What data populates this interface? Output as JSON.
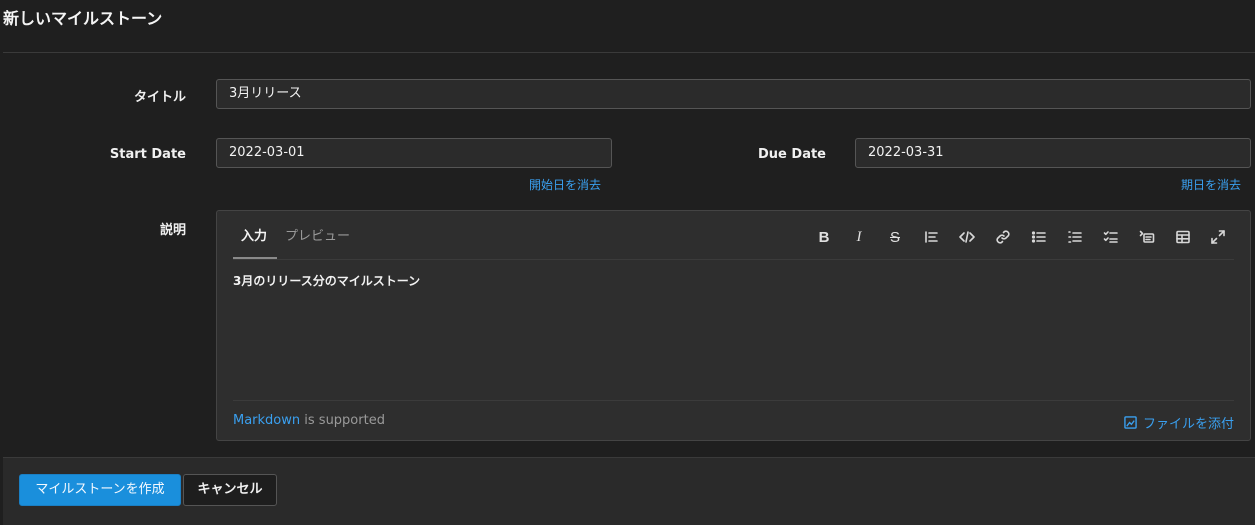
{
  "page": {
    "title": "新しいマイルストーン"
  },
  "form": {
    "title_label": "タイトル",
    "title_value": "3月リリース",
    "start_label": "Start Date",
    "start_value": "2022-03-01",
    "start_clear": "開始日を消去",
    "due_label": "Due Date",
    "due_value": "2022-03-31",
    "due_clear": "期日を消去",
    "desc_label": "説明"
  },
  "editor": {
    "tabs": [
      "入力",
      "プレビュー"
    ],
    "active_tab": "入力",
    "content": "3月のリリース分のマイルストーン",
    "toolbar_icons": [
      "bold-icon",
      "italic-icon",
      "strikethrough-icon",
      "quote-icon",
      "code-icon",
      "link-icon",
      "bullet-list-icon",
      "numbered-list-icon",
      "task-list-icon",
      "collapsible-icon",
      "table-icon",
      "fullscreen-icon"
    ],
    "markdown_link": "Markdown",
    "markdown_suffix": " is supported",
    "attach_label": "ファイルを添付"
  },
  "actions": {
    "create": "マイルストーンを作成",
    "cancel": "キャンセル"
  },
  "colors": {
    "accent": "#1a8fdc",
    "link": "#3aa0f0",
    "background": "#1f1f1f"
  }
}
